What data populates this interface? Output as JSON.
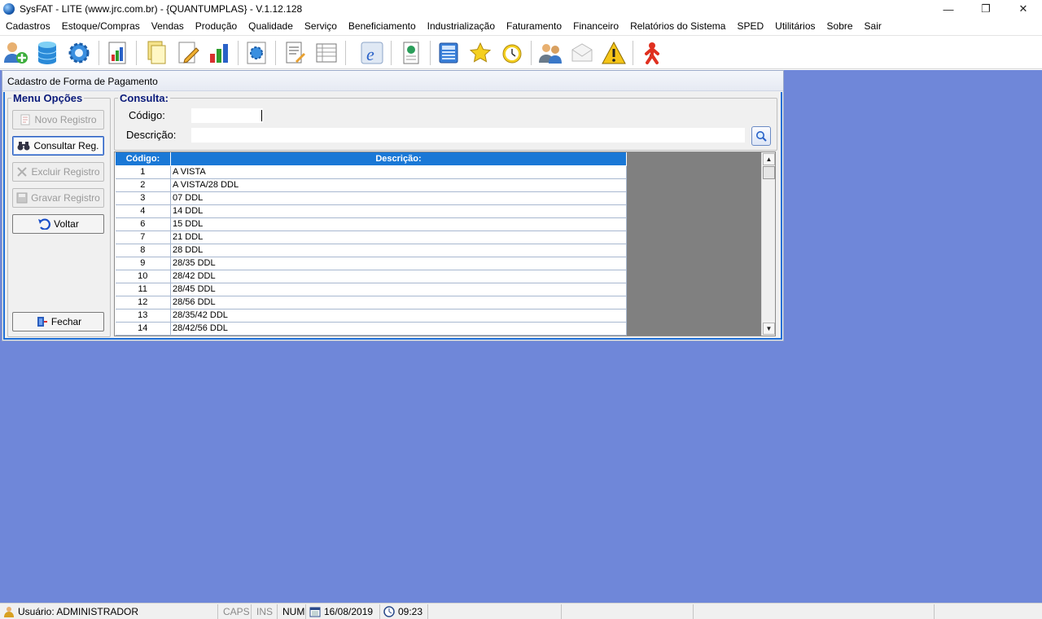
{
  "window": {
    "title": "SysFAT - LITE (www.jrc.com.br) - {QUANTUMPLAS} - V.1.12.128",
    "minimize": "—",
    "restore": "❐",
    "close": "✕"
  },
  "menu": [
    "Cadastros",
    "Estoque/Compras",
    "Vendas",
    "Produção",
    "Qualidade",
    "Serviço",
    "Beneficiamento",
    "Industrialização",
    "Faturamento",
    "Financeiro",
    "Relatórios do Sistema",
    "SPED",
    "Utilitários",
    "Sobre",
    "Sair"
  ],
  "toolbar_icons": [
    "users-add-icon",
    "database-icon",
    "gear-icon",
    "report-chart-icon",
    "documents-icon",
    "edit-document-icon",
    "bar-chart-icon",
    "settings-doc-icon",
    "notes-icon",
    "list-icon",
    "nfe-icon",
    "book-icon",
    "calculator-icon",
    "star-icon",
    "clock-icon",
    "users-chat-icon",
    "mail-icon",
    "warning-icon",
    "exit-person-icon"
  ],
  "form": {
    "title": "Cadastro de Forma de Pagamento",
    "menu_group": "Menu Opções",
    "query_group": "Consulta:",
    "buttons": {
      "novo": "Novo Registro",
      "consultar": "Consultar Reg.",
      "excluir": "Excluir Registro",
      "gravar": "Gravar Registro",
      "voltar": "Voltar",
      "fechar": "Fechar"
    },
    "codigo_label": "Código:",
    "codigo_value": "",
    "descricao_label": "Descrição:",
    "descricao_value": ""
  },
  "grid": {
    "headers": [
      "Código:",
      "Descrição:"
    ],
    "rows": [
      [
        "1",
        "A VISTA"
      ],
      [
        "2",
        "A VISTA/28 DDL"
      ],
      [
        "3",
        "07 DDL"
      ],
      [
        "4",
        "14 DDL"
      ],
      [
        "6",
        "15 DDL"
      ],
      [
        "7",
        "21 DDL"
      ],
      [
        "8",
        "28 DDL"
      ],
      [
        "9",
        "28/35 DDL"
      ],
      [
        "10",
        "28/42 DDL"
      ],
      [
        "11",
        "28/45 DDL"
      ],
      [
        "12",
        "28/56 DDL"
      ],
      [
        "13",
        "28/35/42 DDL"
      ],
      [
        "14",
        "28/42/56 DDL"
      ]
    ]
  },
  "status": {
    "user": "Usuário: ADMINISTRADOR",
    "caps": "CAPS",
    "ins": "INS",
    "num": "NUM",
    "date": "16/08/2019",
    "time": "09:23"
  },
  "colors": {
    "workspace": "#6f87d9",
    "grid_header": "#1a78d6",
    "legend": "#0a1a7a"
  }
}
